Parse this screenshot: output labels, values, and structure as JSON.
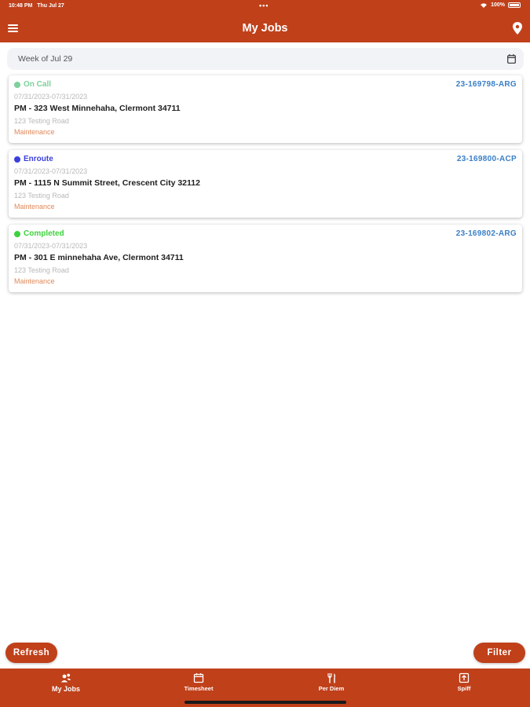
{
  "status_bar": {
    "time": "10:48 PM",
    "date": "Thu Jul 27",
    "battery": "100%"
  },
  "header": {
    "title": "My Jobs"
  },
  "week_picker": {
    "label": "Week of Jul 29"
  },
  "jobs": [
    {
      "status": "On Call",
      "status_color": "#7dd19a",
      "job_id": "23-169798-ARG",
      "dates": "07/31/2023-07/31/2023",
      "address": "PM - 323 West Minnehaha, Clermont 34711",
      "road": "123 Testing Road",
      "type": "Maintenance"
    },
    {
      "status": "Enroute",
      "status_color": "#3b3fdc",
      "job_id": "23-169800-ACP",
      "dates": "07/31/2023-07/31/2023",
      "address": "PM - 1115 N Summit Street, Crescent City 32112",
      "road": "123 Testing Road",
      "type": "Maintenance"
    },
    {
      "status": "Completed",
      "status_color": "#3ed23e",
      "job_id": "23-169802-ARG",
      "dates": "07/31/2023-07/31/2023",
      "address": "PM - 301 E minnehaha Ave, Clermont 34711",
      "road": "123 Testing Road",
      "type": "Maintenance"
    }
  ],
  "actions": {
    "refresh": "Refresh",
    "filter": "Filter"
  },
  "tabs": [
    {
      "label": "My Jobs",
      "icon": "people-icon"
    },
    {
      "label": "Timesheet",
      "icon": "calendar-icon"
    },
    {
      "label": "Per Diem",
      "icon": "fork-knife-icon"
    },
    {
      "label": "Spiff",
      "icon": "spiff-icon"
    }
  ],
  "colors": {
    "brand": "#c0401a",
    "job_id": "#3a7fc7",
    "type": "#e0895a"
  }
}
